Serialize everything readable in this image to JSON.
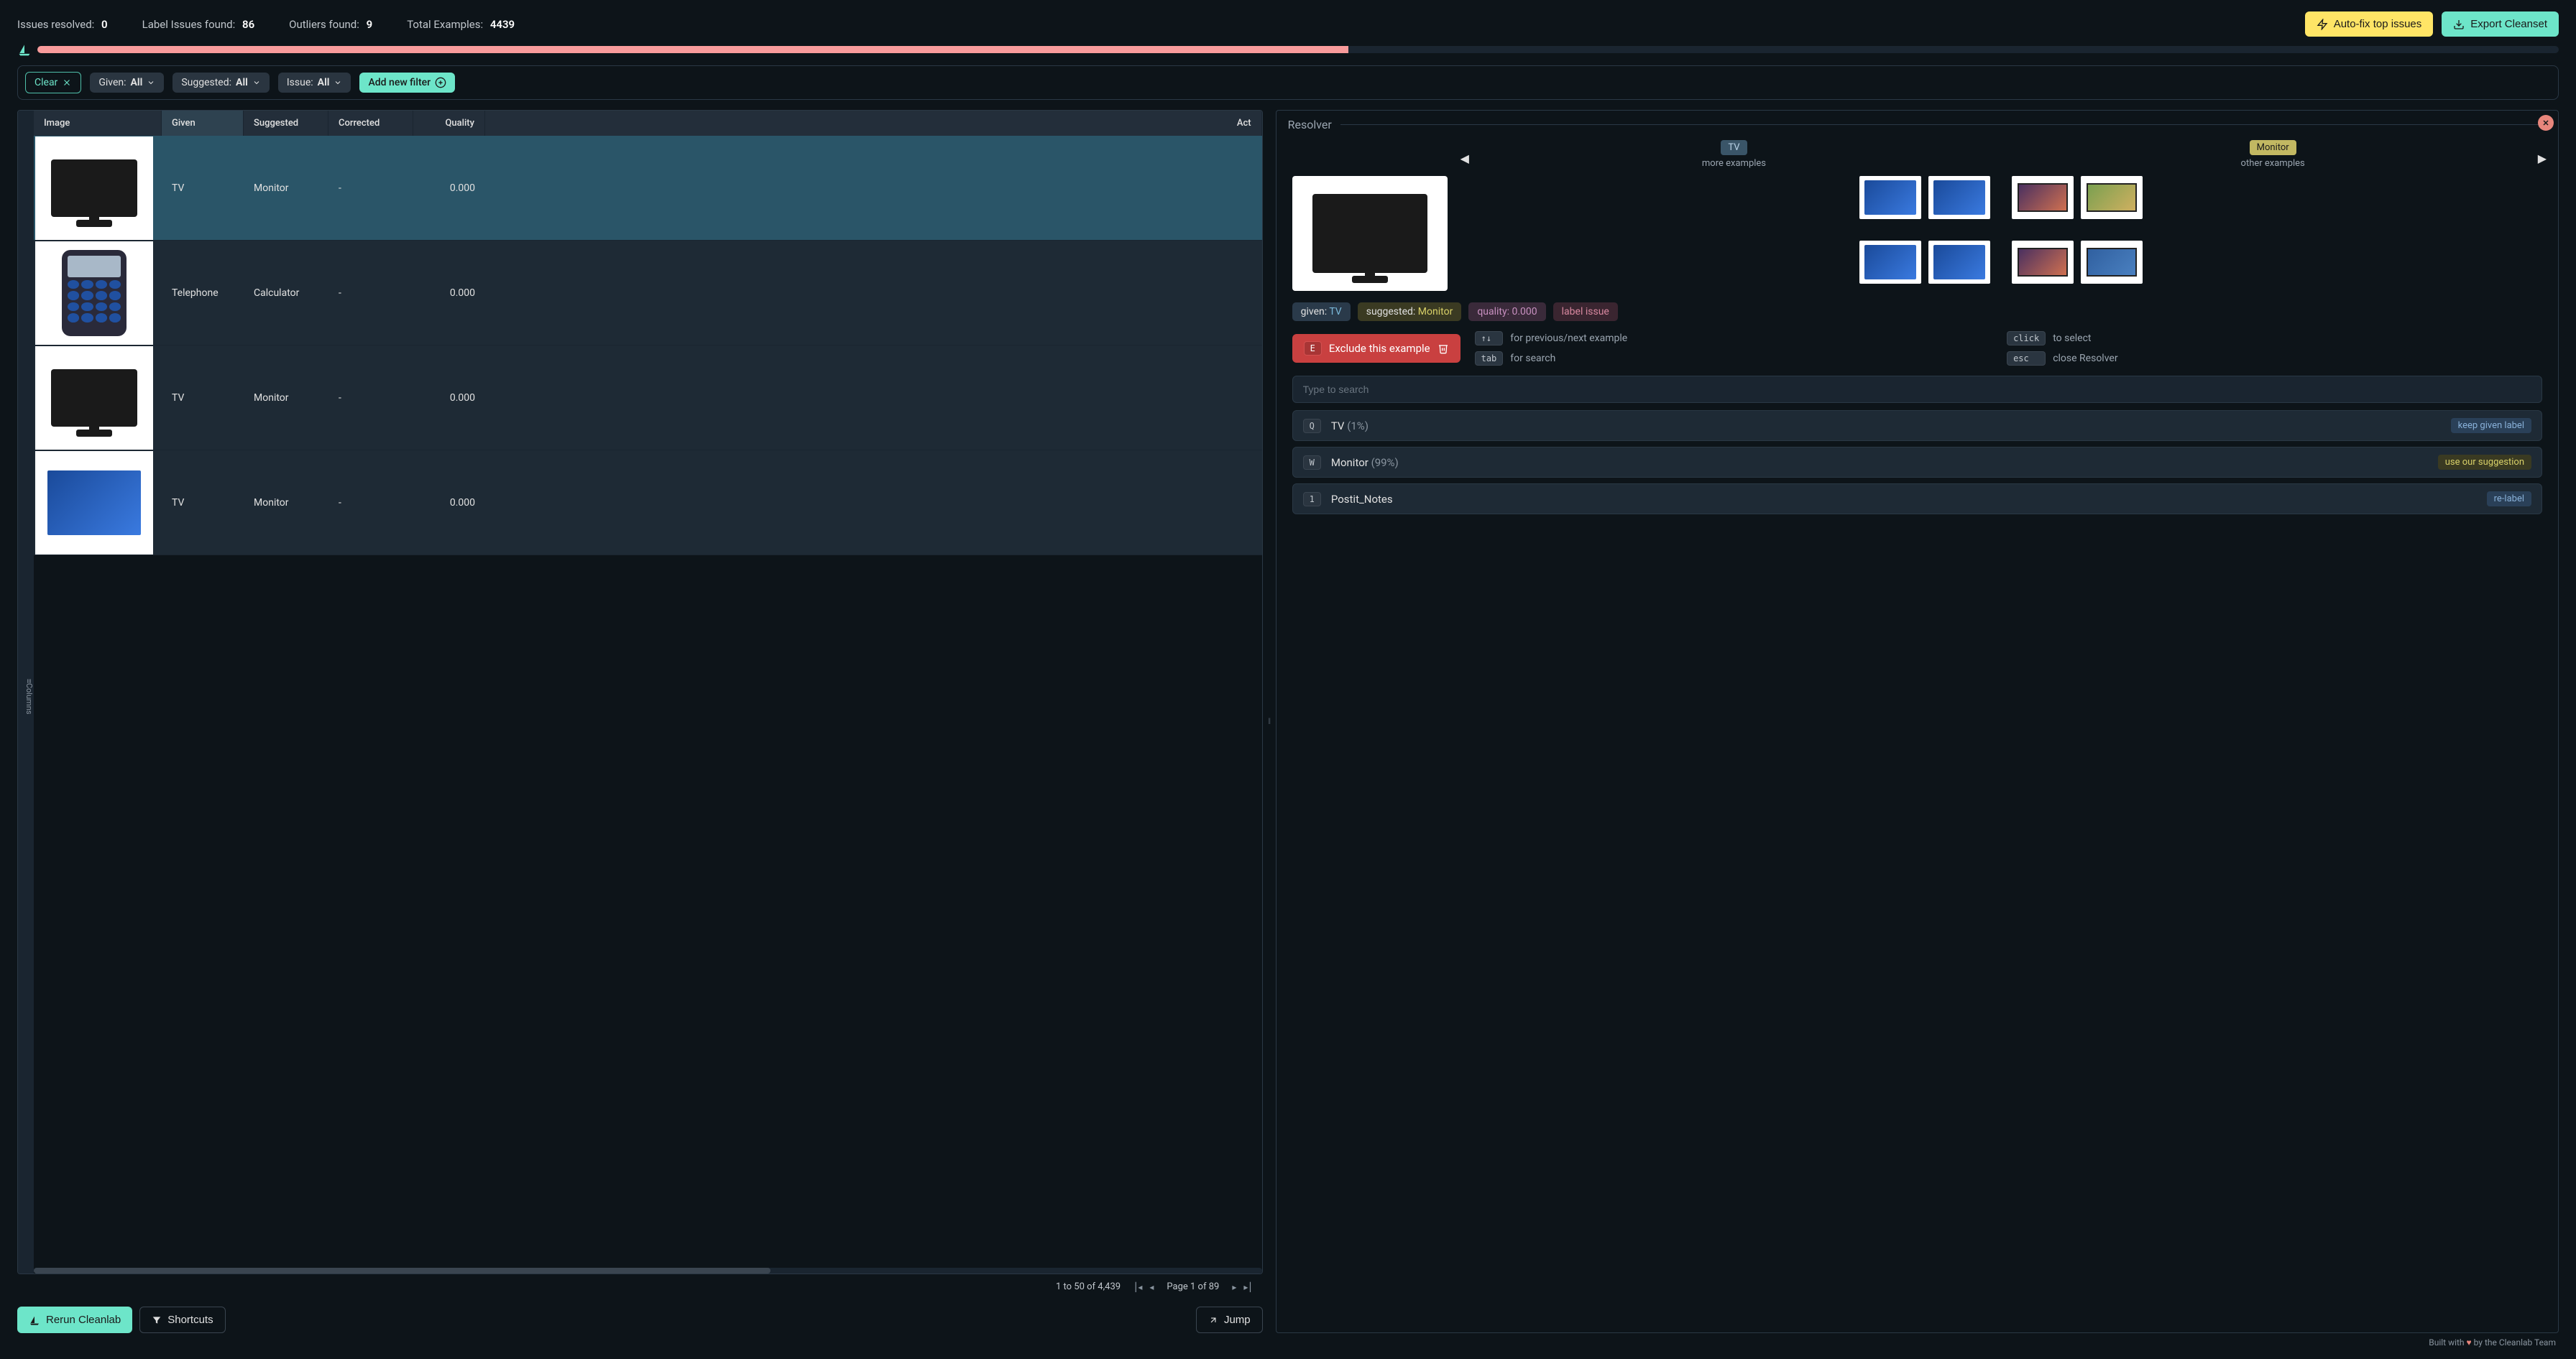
{
  "stats": {
    "issues_resolved_label": "Issues resolved:",
    "issues_resolved_value": "0",
    "label_issues_label": "Label Issues found:",
    "label_issues_value": "86",
    "outliers_label": "Outliers found:",
    "outliers_value": "9",
    "total_label": "Total Examples:",
    "total_value": "4439"
  },
  "header_buttons": {
    "autofix": "Auto-fix top issues",
    "export": "Export Cleanset"
  },
  "filters": {
    "clear": "Clear",
    "given_label": "Given:",
    "given_value": "All",
    "suggested_label": "Suggested:",
    "suggested_value": "All",
    "issue_label": "Issue:",
    "issue_value": "All",
    "add_filter": "Add new filter"
  },
  "table": {
    "columns_tab": "Columns",
    "headers": {
      "image": "Image",
      "given": "Given",
      "suggested": "Suggested",
      "corrected": "Corrected",
      "quality": "Quality",
      "action": "Act"
    },
    "rows": [
      {
        "given": "TV",
        "suggested": "Monitor",
        "corrected": "-",
        "quality": "0.000",
        "selected": true,
        "kind": "tv"
      },
      {
        "given": "Telephone",
        "suggested": "Calculator",
        "corrected": "-",
        "quality": "0.000",
        "selected": false,
        "kind": "phone"
      },
      {
        "given": "TV",
        "suggested": "Monitor",
        "corrected": "-",
        "quality": "0.000",
        "selected": false,
        "kind": "tv"
      },
      {
        "given": "TV",
        "suggested": "Monitor",
        "corrected": "-",
        "quality": "0.000",
        "selected": false,
        "kind": "tvblue"
      }
    ]
  },
  "pagination": {
    "range": "1 to 50 of 4,439",
    "page": "Page 1 of 89"
  },
  "bottom": {
    "rerun": "Rerun Cleanlab",
    "shortcuts": "Shortcuts",
    "jump": "Jump"
  },
  "resolver": {
    "title": "Resolver",
    "groups": {
      "tv_label": "TV",
      "tv_sub": "more examples",
      "monitor_label": "Monitor",
      "monitor_sub": "other examples"
    },
    "pills": {
      "given_k": "given: ",
      "given_v": "TV",
      "suggested_k": "suggested: ",
      "suggested_v": "Monitor",
      "quality": "quality: 0.000",
      "issue": "label issue"
    },
    "exclude": {
      "key": "E",
      "label": "Exclude this example"
    },
    "hints": {
      "arrows_k": "↑↓",
      "arrows_t": "for previous/next example",
      "click_k": "click",
      "click_t": "to select",
      "tab_k": "tab",
      "tab_t": "for search",
      "esc_k": "esc",
      "esc_t": "close Resolver"
    },
    "search_placeholder": "Type to search",
    "labels": [
      {
        "key": "Q",
        "name": "TV",
        "pct": "(1%)",
        "chip": "keep given label",
        "chip_class": "chip-blue"
      },
      {
        "key": "W",
        "name": "Monitor",
        "pct": "(99%)",
        "chip": "use our suggestion",
        "chip_class": "chip-yellow"
      },
      {
        "key": "1",
        "name": "Postit_Notes",
        "pct": "",
        "chip": "re-label",
        "chip_class": "chip-blue"
      }
    ]
  },
  "footer": {
    "prefix": "Built with ",
    "suffix": " by the Cleanlab Team"
  }
}
